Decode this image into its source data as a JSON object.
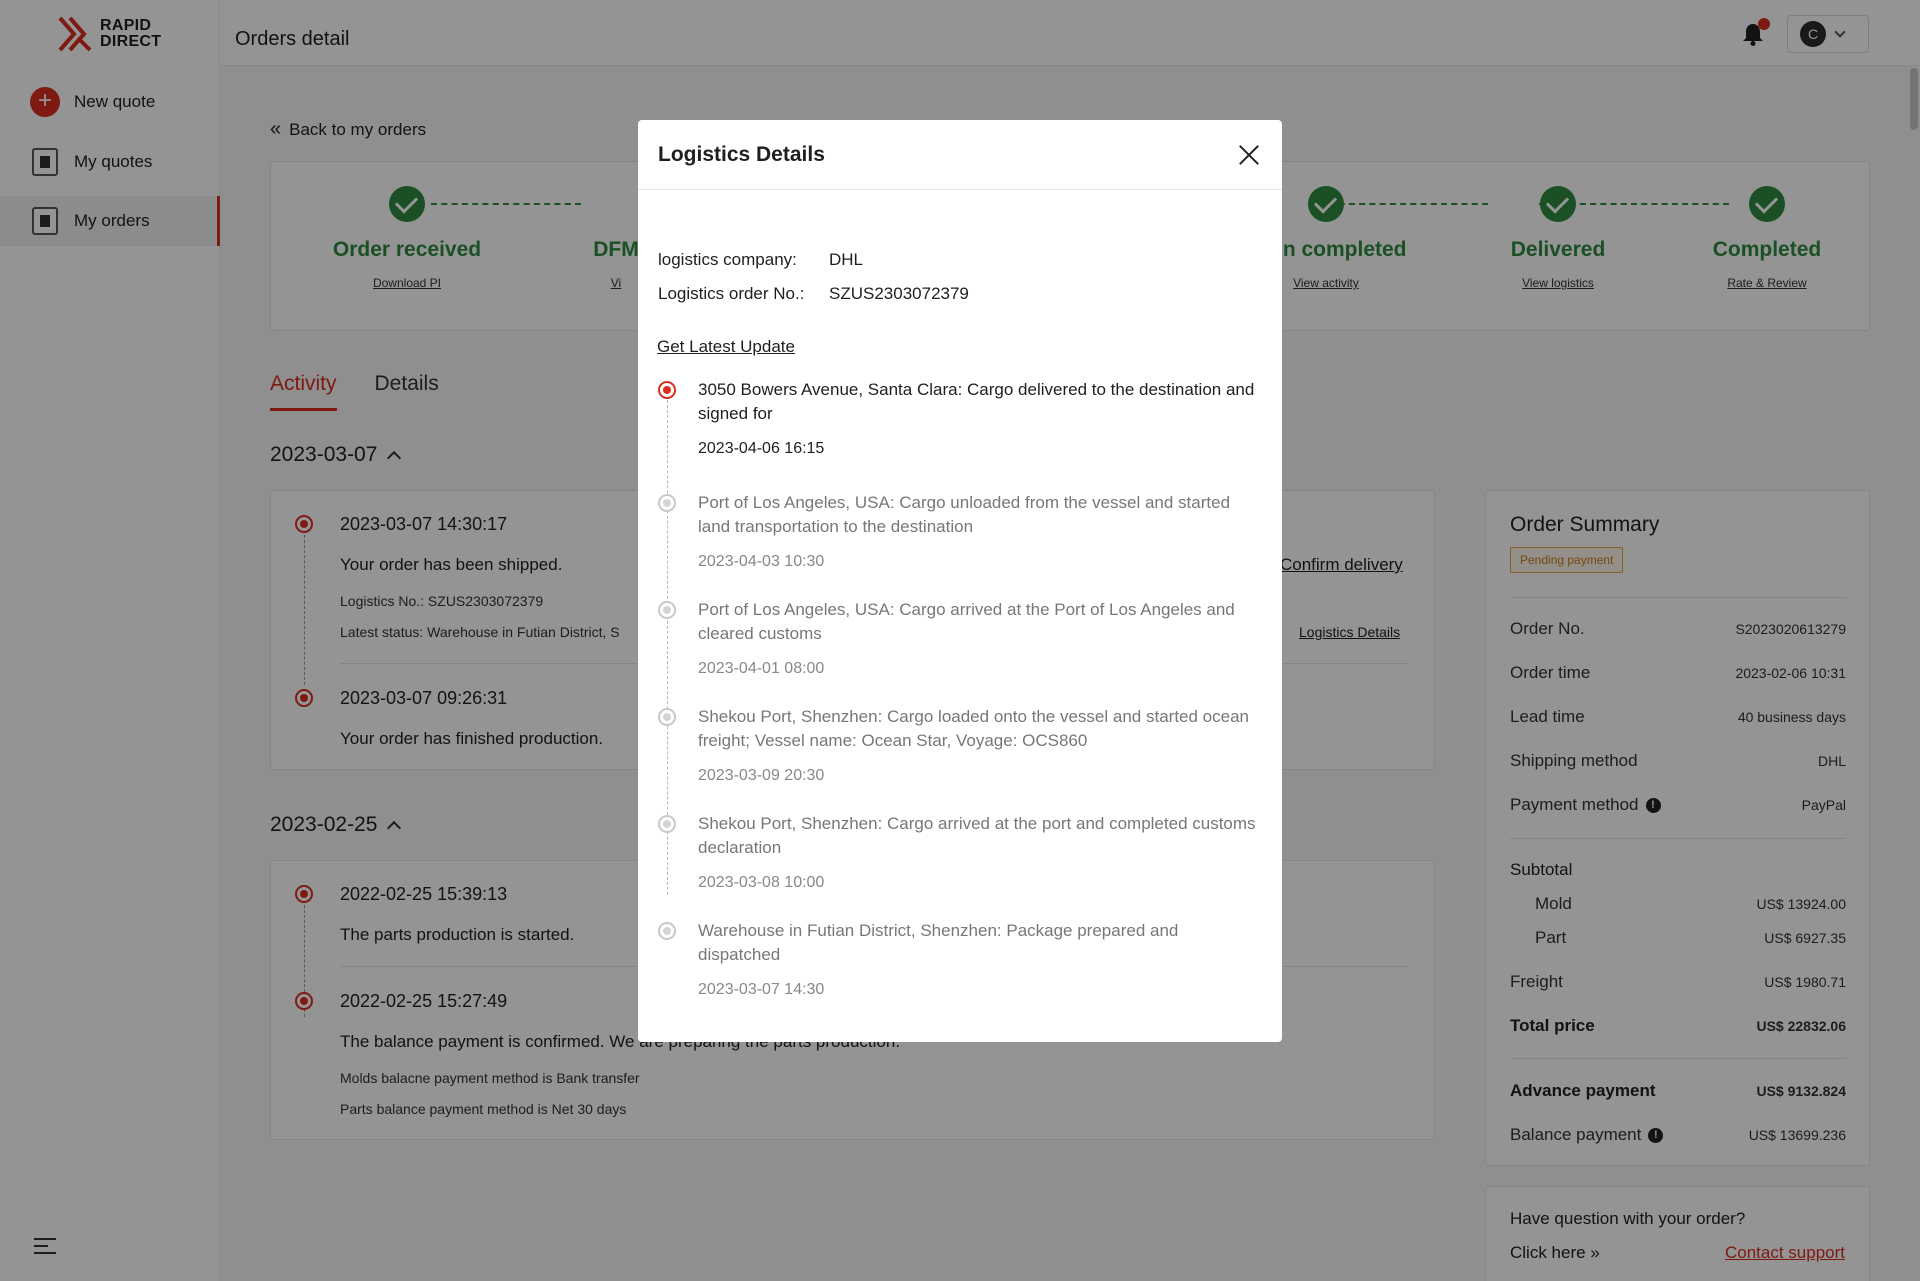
{
  "brand": {
    "line1": "RAPID",
    "line2": "DIRECT"
  },
  "sidebar": {
    "items": [
      {
        "label": "New quote"
      },
      {
        "label": "My quotes"
      },
      {
        "label": "My orders"
      }
    ]
  },
  "header": {
    "title": "Orders detail",
    "avatar_letter": "C"
  },
  "back_link": "Back to my orders",
  "steps": [
    {
      "label": "Order received",
      "link": "Download PI"
    },
    {
      "label": "DFM",
      "link": "Vi"
    },
    {
      "label": "ction completed",
      "link": "View activity"
    },
    {
      "label": "Delivered",
      "link": "View logistics"
    },
    {
      "label": "Completed",
      "link": "Rate & Review"
    }
  ],
  "tabs": [
    {
      "label": "Activity"
    },
    {
      "label": "Details"
    }
  ],
  "activity_groups": [
    {
      "date": "2023-03-07",
      "entries": [
        {
          "time": "2023-03-07  14:30:17",
          "text": "Your order has been shipped.",
          "details": [
            "Logistics No.: SZUS2303072379",
            "Latest status: Warehouse in Futian District, S"
          ],
          "action": "Confirm delivery",
          "action2": "Logistics Details"
        },
        {
          "time": "2023-03-07  09:26:31",
          "text": "Your order has finished production."
        }
      ]
    },
    {
      "date": "2023-02-25",
      "entries": [
        {
          "time": "2022-02-25  15:39:13",
          "text": "The parts production is started."
        },
        {
          "time": "2022-02-25  15:27:49",
          "text": "The balance payment is confirmed. We are preparing the parts production.",
          "details": [
            "Molds balacne payment method is Bank transfer",
            "Parts balance payment method is Net 30 days"
          ]
        }
      ]
    }
  ],
  "summary": {
    "title": "Order Summary",
    "status": "Pending payment",
    "rows": [
      {
        "label": "Order No.",
        "value": "S2023020613279"
      },
      {
        "label": "Order time",
        "value": "2023-02-06 10:31"
      },
      {
        "label": "Lead time",
        "value": "40 business days"
      },
      {
        "label": "Shipping method",
        "value": "DHL"
      },
      {
        "label": "Payment method",
        "value": "PayPal"
      }
    ],
    "subtotal_label": "Subtotal",
    "mold": {
      "label": "Mold",
      "value": "US$ 13924.00"
    },
    "part": {
      "label": "Part",
      "value": "US$ 6927.35"
    },
    "freight": {
      "label": "Freight",
      "value": "US$ 1980.71"
    },
    "total": {
      "label": "Total price",
      "value": "US$ 22832.06"
    },
    "advance": {
      "label": "Advance payment",
      "value": "US$ 9132.824"
    },
    "balance": {
      "label": "Balance payment",
      "value": "US$ 13699.236"
    }
  },
  "help": {
    "question": "Have question with your order?",
    "click": "Click here",
    "contact": "Contact support"
  },
  "modal": {
    "title": "Logistics Details",
    "company_label": "logistics company:",
    "company": "DHL",
    "order_label": "Logistics order No.:",
    "order_no": "SZUS2303072379",
    "update_link": "Get Latest Update",
    "events": [
      {
        "text": "3050 Bowers Avenue, Santa Clara: Cargo delivered to the destination and signed for",
        "time": "2023-04-06 16:15",
        "active": true
      },
      {
        "text": "Port of Los Angeles, USA: Cargo unloaded from the vessel and started land transportation to the destination",
        "time": "2023-04-03 10:30"
      },
      {
        "text": "Port of Los Angeles, USA: Cargo arrived at the Port of Los Angeles and cleared customs",
        "time": "2023-04-01 08:00"
      },
      {
        "text": "Shekou Port, Shenzhen: Cargo loaded onto the vessel and started ocean freight; Vessel name: Ocean Star, Voyage: OCS860",
        "time": "2023-03-09 20:30"
      },
      {
        "text": "Shekou Port, Shenzhen: Cargo arrived at the port and completed customs declaration",
        "time": "2023-03-08 10:00"
      },
      {
        "text": "Warehouse in Futian District, Shenzhen: Package prepared and dispatched",
        "time": "2023-03-07 14:30"
      }
    ]
  }
}
